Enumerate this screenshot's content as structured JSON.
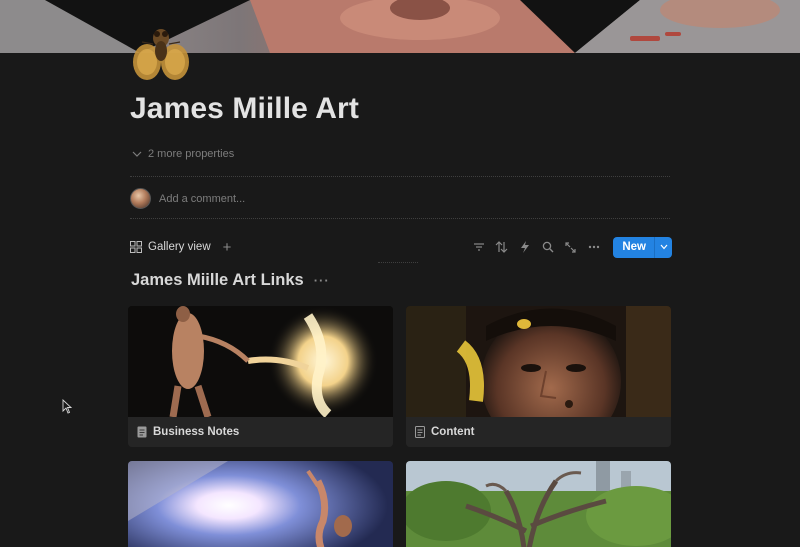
{
  "page": {
    "title": "James Miille Art",
    "more_properties": "2 more properties",
    "comment_placeholder": "Add a comment..."
  },
  "view": {
    "tab_label": "Gallery view",
    "new_button": "New",
    "tool_icons": [
      "filter-icon",
      "sort-icon",
      "automation-icon",
      "search-icon",
      "expand-icon",
      "more-icon"
    ]
  },
  "section": {
    "title": "James Miille Art Links",
    "more": "···"
  },
  "cards": [
    {
      "label": "Business Notes",
      "image": "dancer-with-light"
    },
    {
      "label": "Content",
      "image": "portrait-with-gold-paint"
    },
    {
      "label": "",
      "image": "underwater-light-burst"
    },
    {
      "label": "",
      "image": "tree-sculpture-park"
    }
  ],
  "colors": {
    "background": "#191919",
    "accent": "#2383e2",
    "text": "#d4d4d4",
    "muted": "#7d7d7d"
  }
}
